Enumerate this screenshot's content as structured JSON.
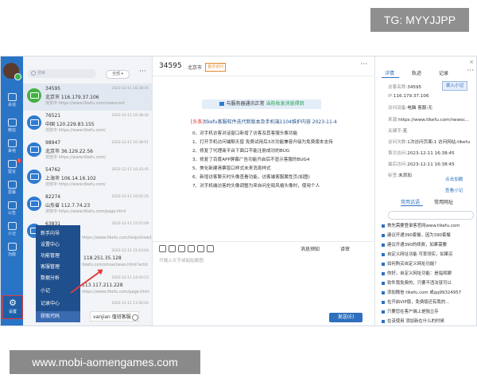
{
  "overlays": {
    "tg_badge": "TG: MYYJJPP",
    "site_watermark": "www.mobi-aomengames.com"
  },
  "nav": {
    "items": [
      {
        "label": "会话",
        "icon": "chat-icon"
      },
      {
        "label": "微信",
        "icon": "wechat-icon"
      },
      {
        "label": "来电",
        "icon": "phone-icon"
      },
      {
        "label": "留言",
        "icon": "message-icon",
        "badge": "1"
      },
      {
        "label": "屏幕",
        "icon": "screen-icon"
      },
      {
        "label": "公告",
        "icon": "notice-icon"
      },
      {
        "label": "小记",
        "icon": "note-icon"
      },
      {
        "label": "功能",
        "icon": "function-icon"
      }
    ],
    "settings_label": "设置"
  },
  "list": {
    "search_placeholder": "搜索",
    "filter_label": "全部 ▾",
    "more": "···",
    "conversations": [
      {
        "id": "34595",
        "time": "2023-12-11 16:38:45",
        "location": "北京市   116.179.37.106",
        "url": "浏览中 https://www.tlkefu.com/newscont"
      },
      {
        "id": "76521",
        "time": "2023-12-11 16:38:42",
        "location": "中国 120.229.83.155",
        "url": "浏览中 https://www.tlkefu.com/"
      },
      {
        "id": "98947",
        "time": "2023-12-11 16:38:01",
        "location": "北京市 36.129.22.56",
        "url": "浏览中 https://www.tlkefu.com/"
      },
      {
        "id": "54762",
        "time": "2023-12-11 16:33:45",
        "location": "上海市  106.14.16.102",
        "url": "浏览中 https://www.tlkefu.com/"
      },
      {
        "id": "82274",
        "time": "2023-12-11 16:02:25",
        "location": "山东省  112.7.74.23",
        "url": "浏览中 https://www.tlkefu.com/page.html"
      },
      {
        "id": "63831",
        "time": "2023-12-11 15:57:09",
        "location": "",
        "url": "https://www.tlkefu.com/help/show1"
      },
      {
        "id": "",
        "time": "2023-12-11 15:10:04",
        "location": "118.251.35.128",
        "url": "tlkefu.com/show/news.html?artid"
      },
      {
        "id": "",
        "time": "2023-12-11 14:43:15",
        "location": "113.117.211.228",
        "url": "https://www.tlkefu.com/page.html"
      },
      {
        "id": "",
        "time": "2023-12-11 13:50:02",
        "location": "",
        "url": ""
      }
    ]
  },
  "menu": {
    "items": [
      "新手向导",
      "设置中心",
      "功能管理",
      "客服管理",
      "数据分析",
      "小记",
      "记录中心",
      "获取代码"
    ],
    "tip": "vanjian 值班客服"
  },
  "chat": {
    "visitor_id": "34595",
    "city": "北京市",
    "tag": "首次访问",
    "more": "···",
    "notice_prefix": "与服务器通讯正常",
    "notice_suffix": "当前收发消息得到",
    "news_title_red": "[头条]",
    "news_title_blue": "tlkefu客服软件迭代新版本及手机端1104维护内容 2023-11-4",
    "news_lines": [
      "0、对手机访客对话窗口新增了访客及其客服头像功能",
      "1、打开手机访问端聊天窗 免费试用后3次功能兼容升级为免费版本支持",
      "2、修复了代理商平台下面口不能注册成功的BUG",
      "3、修复了百度APP屏幕广告功能开启后不显示客服的BUG4",
      "5、美化新建清票窗口样式未来消息样式",
      "6、新增访客聊天时头像查看功能，访客端客服属性页(如图)",
      "7、对手机端访客的头像调整为来自问全局风格头像时，使用个人"
    ],
    "toolbar": {
      "speech_label": "消息预知",
      "translate_label": "译审"
    },
    "input_placeholder": "可输入文字或粘贴截图",
    "send_label": "发送(E)"
  },
  "side": {
    "tabs": [
      "详情",
      "轨迹",
      "记录"
    ],
    "close": "×",
    "more": "···",
    "save_label": "录入小记",
    "info": [
      {
        "label": "访客名称:",
        "value": "34595"
      },
      {
        "label": "IP:",
        "value": "116.179.37.106"
      },
      {
        "label": "访问设备:",
        "value": "电脑   客服:无"
      },
      {
        "label": "来源:",
        "value": "https://www.tlkefu.com/newsc..."
      },
      {
        "label": "关键字:",
        "value": "无"
      },
      {
        "label": "访问次数:",
        "value": "1次访问页面:1  访问网站:tlkefu"
      },
      {
        "label": "首次访问:",
        "value": "2023-12-11 16:38:45"
      },
      {
        "label": "最后访问:",
        "value": "2023-12-11 16:38:45"
      },
      {
        "label": "标签:",
        "value": "未添加"
      }
    ],
    "links": {
      "add": "点击加载",
      "view": "查看小记"
    },
    "phrase_tabs": [
      "常用话语",
      "常用网址"
    ],
    "phrases": [
      "首先需要登录客官网www.tlkefu.com",
      "建议开通390套餐，因为390套餐",
      "建议开通390的续费，如果需要",
      "自定义网址功能 可率领实，如果买",
      "如何购买自定义网址功能？",
      "你好，自定义网址功能：是指将脚",
      "软件我免费的，只要不违法就可以",
      "添加微信 tlkefu.com 或qq99324957",
      "在开启VIP版，免费版还有我的...",
      "只要您在客户端上是独立存",
      "在该使用 添加新在什么的时候"
    ]
  }
}
